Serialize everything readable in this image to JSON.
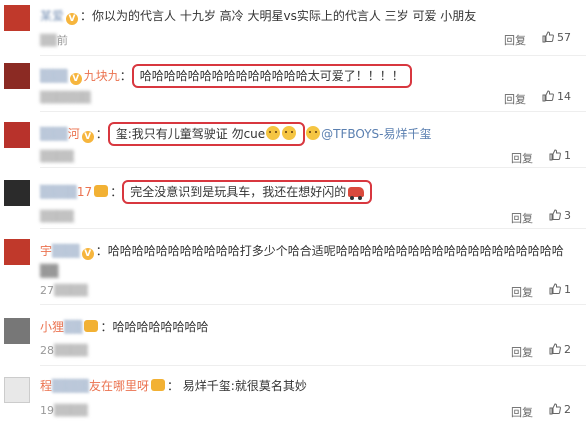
{
  "comments": [
    {
      "username": "爱",
      "text": "你以为的代言人 十九岁 高冷 大明星vs实际上的代言人 三岁 可爱 小朋友",
      "time": "前",
      "reply": "回复",
      "likes": "57",
      "avatar_color": "#c0392b"
    },
    {
      "username": "九块九",
      "text": "哈哈哈哈哈哈哈哈哈哈哈哈哈哈太可爱了！！！！",
      "time": "",
      "reply": "回复",
      "likes": "14",
      "avatar_color": "#8b2a23"
    },
    {
      "username": "河",
      "text": "玺:我只有儿童驾驶证 勿cue",
      "mention": "@TFBOYS-易烊千玺",
      "time": "",
      "reply": "回复",
      "likes": "1",
      "avatar_color": "#b8322b"
    },
    {
      "username": "17",
      "text": "完全没意识到是玩具车，我还在想好闪的",
      "time": "",
      "reply": "回复",
      "likes": "3",
      "avatar_color": "#2b2b2b"
    },
    {
      "username": "宇",
      "text": "哈哈哈哈哈哈哈哈哈哈哈打多少个哈合适呢哈哈哈哈哈哈哈哈哈哈哈哈哈哈哈哈哈哈哈",
      "time": "27",
      "reply": "回复",
      "likes": "1",
      "avatar_color": "#c0392b"
    },
    {
      "username": "小狸",
      "text": "哈哈哈哈哈哈哈哈",
      "time": "28",
      "reply": "回复",
      "likes": "2",
      "avatar_color": "#777777"
    },
    {
      "username": "程",
      "username_suffix": "友在哪里呀",
      "text": "易烊千玺:就很莫名其妙",
      "time": "19",
      "reply": "回复",
      "likes": "2",
      "avatar_color": "#999999"
    }
  ],
  "colors": {
    "highlight_border": "#d8373f",
    "username": "#eb7350",
    "mention": "#5a7fb0"
  }
}
